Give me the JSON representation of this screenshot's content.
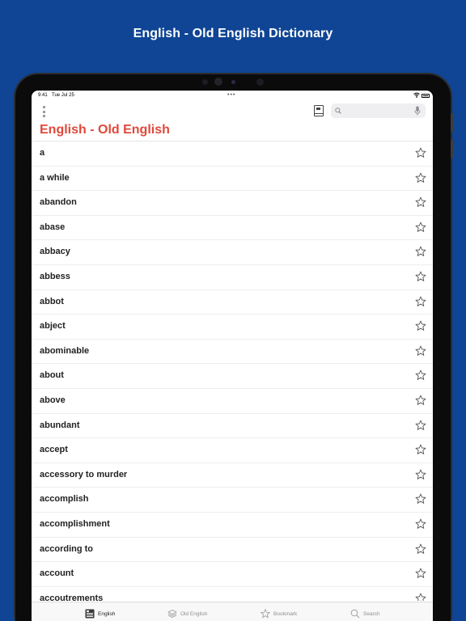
{
  "promo": {
    "title": "English - Old English Dictionary"
  },
  "status_bar": {
    "time": "9:41",
    "date": "Tue Jul 25",
    "dots": "•••"
  },
  "toolbar": {
    "search_placeholder": ""
  },
  "nav": {
    "title": "English - Old English"
  },
  "words": [
    "a",
    "a while",
    "abandon",
    "abase",
    "abbacy",
    "abbess",
    "abbot",
    "abject",
    "abominable",
    "about",
    "above",
    "abundant",
    "accept",
    "accessory to murder",
    "accomplish",
    "accomplishment",
    "according to",
    "account",
    "accoutrements"
  ],
  "tabs": [
    {
      "label": "English",
      "icon": "dictionary-book-icon",
      "active": true
    },
    {
      "label": "Old English",
      "icon": "stack-icon",
      "active": false
    },
    {
      "label": "Bookmark",
      "icon": "star-icon",
      "active": false
    },
    {
      "label": "Search",
      "icon": "search-icon",
      "active": false
    }
  ],
  "colors": {
    "background": "#0f4594",
    "title_accent": "#e0483a",
    "screen": "#ffffff"
  }
}
